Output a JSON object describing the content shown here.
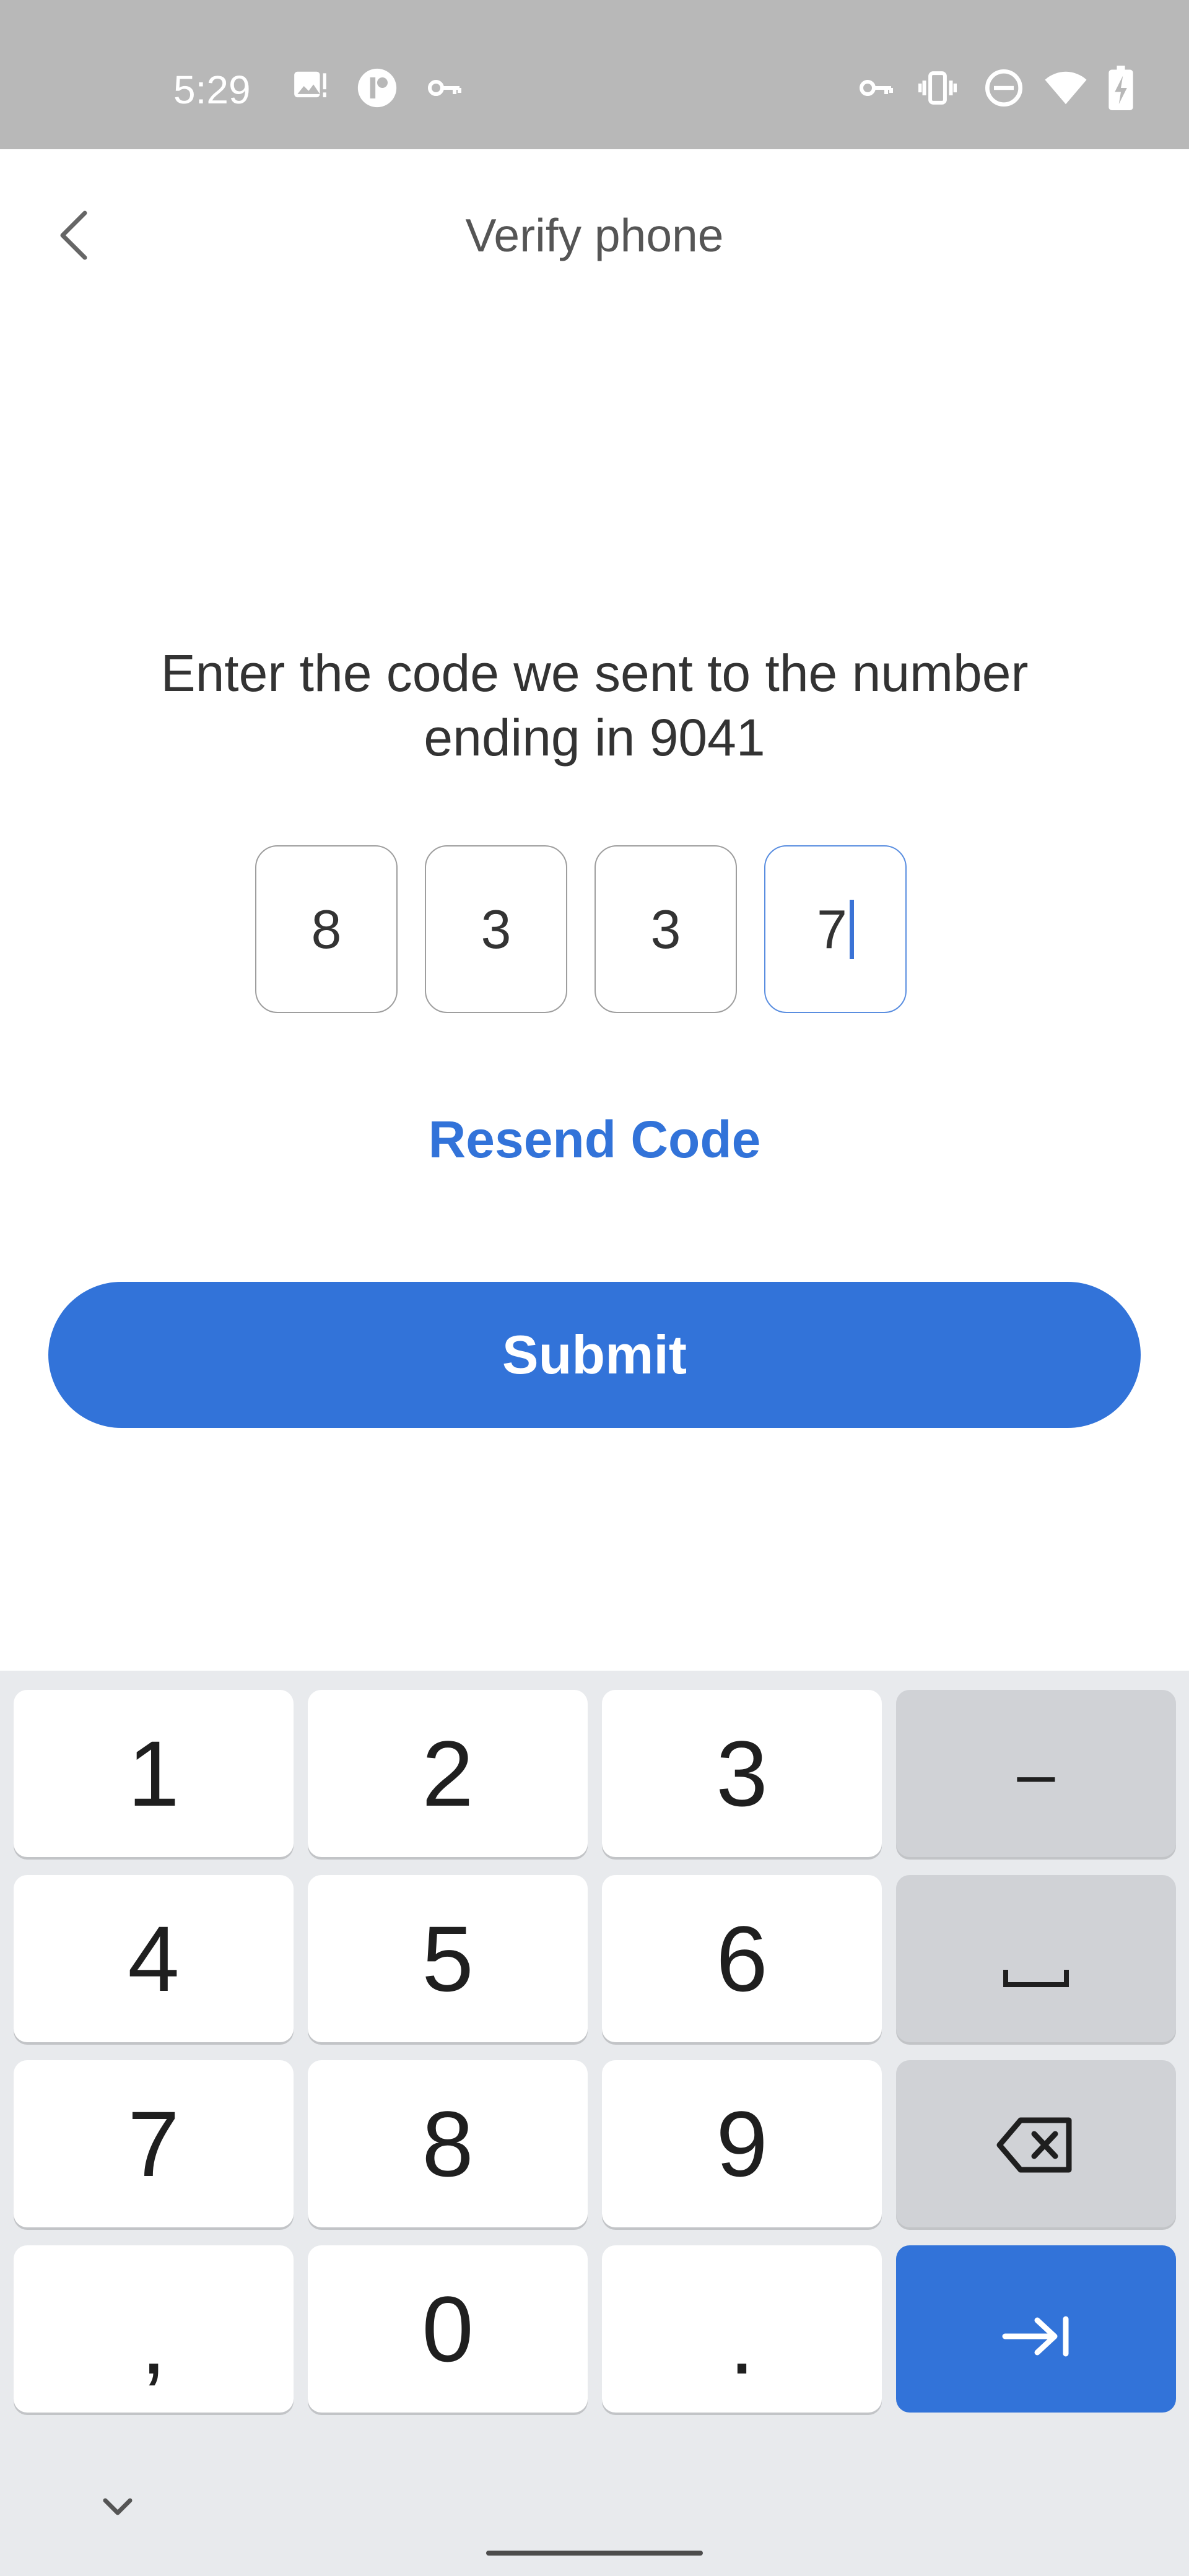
{
  "status_bar": {
    "time": "5:29",
    "left_icons": [
      "image-alert-icon",
      "app-logo-icon",
      "vpn-key-icon"
    ],
    "right_icons": [
      "vpn-key-icon",
      "vibrate-icon",
      "do-not-disturb-icon",
      "wifi-icon",
      "battery-charging-icon"
    ]
  },
  "header": {
    "back_icon": "chevron-left-icon",
    "title": "Verify phone"
  },
  "main": {
    "instruction": "Enter the code we sent to the number ending in 9041",
    "code_digits": [
      "8",
      "3",
      "3",
      "7"
    ],
    "resend_label": "Resend Code",
    "submit_label": "Submit"
  },
  "colors": {
    "accent": "#3273d9",
    "status_bar_bg": "#b8b8b8",
    "keyboard_bg": "#e8eaed",
    "function_key_bg": "#d0d2d6"
  },
  "keyboard": {
    "rows": [
      [
        "1",
        "2",
        "3",
        "–"
      ],
      [
        "4",
        "5",
        "6",
        "space-icon"
      ],
      [
        "7",
        "8",
        "9",
        "backspace-icon"
      ],
      [
        ",",
        "0",
        ".",
        "tab-next-icon"
      ]
    ],
    "collapse_icon": "chevron-down-icon"
  }
}
